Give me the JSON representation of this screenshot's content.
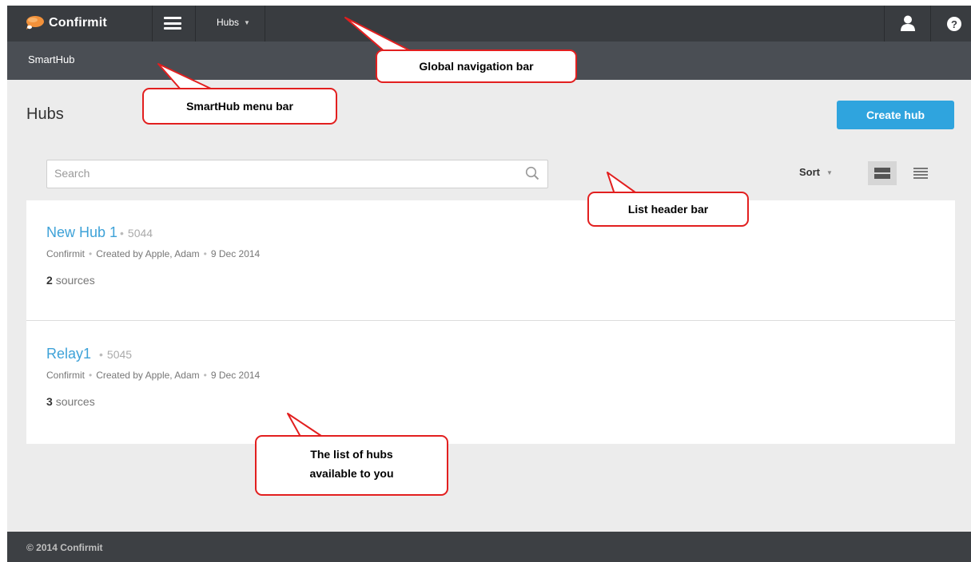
{
  "global_nav": {
    "brand": "Confirmit",
    "menu_label": "Hubs"
  },
  "smarthub_bar": {
    "title": "SmartHub"
  },
  "page": {
    "title": "Hubs",
    "create_button": "Create hub"
  },
  "list_header": {
    "search_placeholder": "Search",
    "sort_label": "Sort"
  },
  "hubs": [
    {
      "name": "New Hub 1",
      "id": "5044",
      "company": "Confirmit",
      "created_by": "Created by Apple, Adam",
      "date": "9 Dec 2014",
      "source_count": "2",
      "sources_label": "sources"
    },
    {
      "name": "Relay1",
      "id": "5045",
      "company": "Confirmit",
      "created_by": "Created by Apple, Adam",
      "date": "9 Dec 2014",
      "source_count": "3",
      "sources_label": "sources"
    }
  ],
  "footer": {
    "copyright": "© 2014 Confirmit"
  },
  "callouts": {
    "global_nav": "Global navigation bar",
    "smarthub_menu": "SmartHub menu bar",
    "list_header": "List header bar",
    "hub_list_line1": "The list of hubs",
    "hub_list_line2": "available to you"
  },
  "colors": {
    "accent": "#2fa4de",
    "link": "#3ea2d8",
    "callout_border": "#e21f1f",
    "nav_bg": "#393c40"
  },
  "icons": {
    "logo": "confirmit-logo-icon",
    "menu": "hamburger-icon",
    "user": "user-icon",
    "help": "help-icon",
    "search": "search-icon",
    "view_wide": "list-view-wide-icon",
    "view_compact": "list-view-compact-icon"
  }
}
